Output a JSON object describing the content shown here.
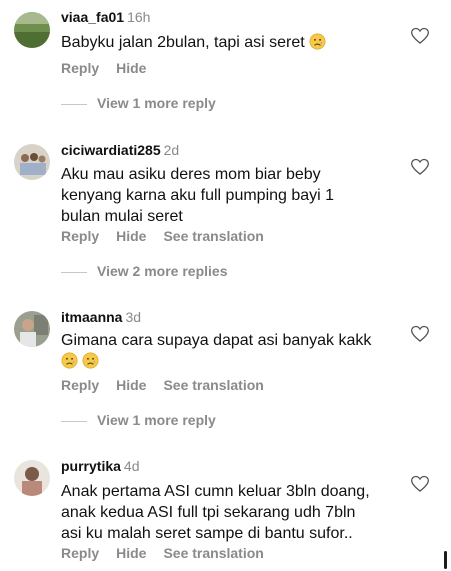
{
  "comments": [
    {
      "username": "viaa_fa01",
      "time": "16h",
      "lines": [
        "Babyku jalan 2bulan, tapi asi seret"
      ],
      "emoji_after_last_line": 1,
      "actions": {
        "reply": "Reply",
        "hide": "Hide"
      },
      "more_replies": "View 1 more reply"
    },
    {
      "username": "ciciwardiati285",
      "time": "2d",
      "lines": [
        "Aku mau asiku deres mom biar beby",
        "kenyang karna aku full pumping bayi 1",
        "bulan mulai seret"
      ],
      "actions": {
        "reply": "Reply",
        "hide": "Hide",
        "translate": "See translation"
      },
      "more_replies": "View 2 more replies"
    },
    {
      "username": "itmaanna",
      "time": "3d",
      "lines": [
        "Gimana cara supaya dapat asi banyak kakk"
      ],
      "emoji_line_count": 2,
      "actions": {
        "reply": "Reply",
        "hide": "Hide",
        "translate": "See translation"
      },
      "more_replies": "View 1 more reply"
    },
    {
      "username": "purrytika",
      "time": "4d",
      "lines": [
        "Anak pertama ASI cumn keluar 3bln doang,",
        "anak kedua ASI full tpi sekarang udh 7bln",
        "asi ku malah seret sampe di bantu sufor.."
      ],
      "actions": {
        "reply": "Reply",
        "hide": "Hide",
        "translate": "See translation"
      }
    }
  ],
  "icons": {
    "like": "heart-outline-icon",
    "emoji": "crying-face-emoji"
  },
  "colors": {
    "secondary_text": "#8a8a8a",
    "primary_text": "#111111",
    "emoji_yellow": "#f7c948"
  }
}
